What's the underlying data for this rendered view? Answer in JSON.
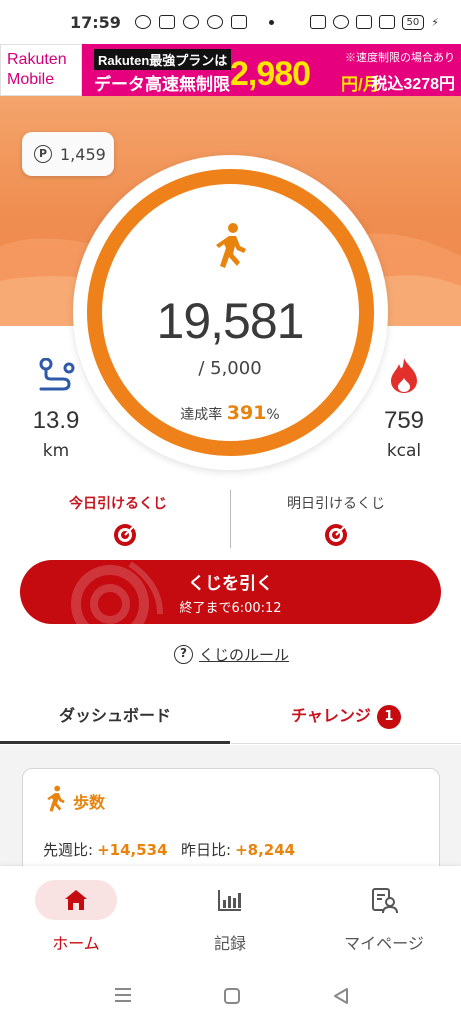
{
  "status_bar": {
    "time": "17:59",
    "battery": "50"
  },
  "ad": {
    "logo_line1": "Rakuten",
    "logo_line2": "Mobile",
    "headline_brand": "Rakuten最強プランは",
    "headline": "データ高速無制限",
    "price": "2,980",
    "price_unit": "円/月",
    "note": "※速度制限の場合あり",
    "tax_price": "税込3278円"
  },
  "points": {
    "value": "1,459",
    "icon_letter": "P"
  },
  "steps": {
    "count": "19,581",
    "goal": "/ 5,000",
    "rate_label": "達成率",
    "rate_value": "391",
    "rate_unit": "%"
  },
  "distance": {
    "value": "13.9",
    "unit": "km"
  },
  "calories": {
    "value": "759",
    "unit": "kcal"
  },
  "lottery": {
    "today_label": "今日引けるくじ",
    "tomorrow_label": "明日引けるくじ",
    "draw_label": "くじを引く",
    "draw_sub": "終了まで6:00:12",
    "rules_label": "くじのルール",
    "rules_icon": "?"
  },
  "tabs": {
    "dashboard": "ダッシュボード",
    "challenge": "チャレンジ",
    "challenge_badge": "1"
  },
  "card": {
    "title": "歩数",
    "weekly_label": "先週比:",
    "weekly_value": "+14,534",
    "daily_label": "昨日比:",
    "daily_value": "+8,244"
  },
  "nav": {
    "home": "ホーム",
    "records": "記録",
    "mypage": "マイページ"
  },
  "colors": {
    "accent": "#ee8119",
    "brand_red": "#c50a10"
  }
}
